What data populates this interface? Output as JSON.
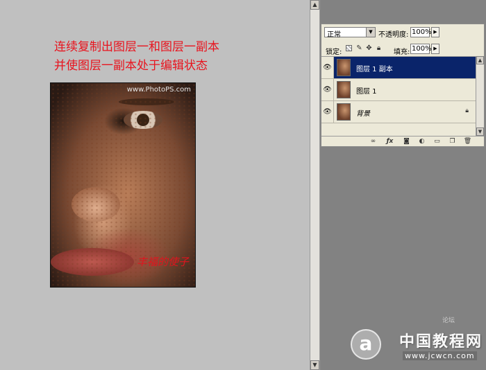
{
  "canvas": {
    "annotation_line1": "连续复制出图层一和图层一副本",
    "annotation_line2": "并使图层一副本处于编辑状态",
    "photo_watermark": "www.PhotoPS.com",
    "photo_signature": "丰福的使子"
  },
  "layers_panel": {
    "blend_mode": "正常",
    "opacity_label": "不透明度:",
    "opacity_value": "100%",
    "lock_label": "锁定:",
    "fill_label": "填充:",
    "fill_value": "100%",
    "layers": [
      {
        "name": "图层 1 副本",
        "selected": true,
        "visible": true
      },
      {
        "name": "图层 1",
        "selected": false,
        "visible": true
      },
      {
        "name": "背景",
        "selected": false,
        "visible": true,
        "locked": true
      }
    ]
  },
  "site_logo": {
    "title": "中国教程网",
    "url": "www.jcwcn.com",
    "tag": "论坛"
  },
  "colors": {
    "annotation_red": "#e8141e",
    "selection_blue": "#0a246a",
    "workspace_gray": "#828282",
    "canvas_gray": "#c0c0c0"
  },
  "icons": {
    "visibility": "eye-icon",
    "layer_lock": "lock-icon",
    "toolbar": [
      "link-icon",
      "fx-icon",
      "mask-icon",
      "adjustment-icon",
      "folder-icon",
      "new-layer-icon",
      "trash-icon"
    ]
  }
}
